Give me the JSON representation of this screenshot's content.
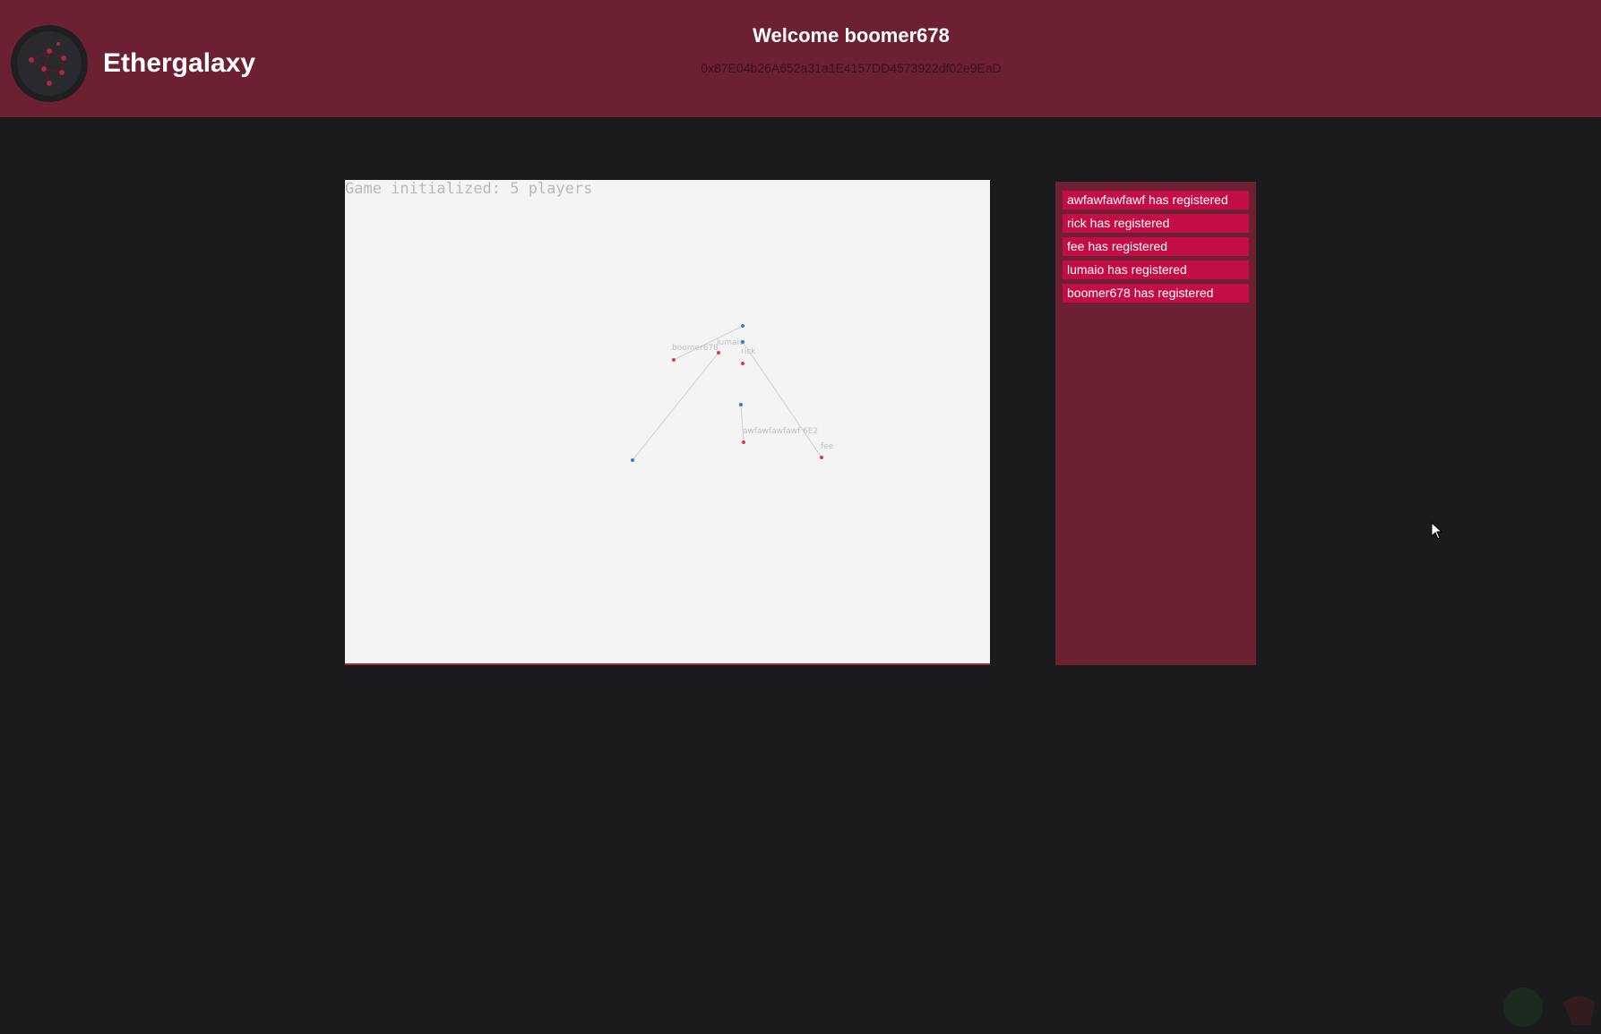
{
  "header": {
    "brand": "Ethergalaxy",
    "welcome": "Welcome boomer678",
    "address": "0x87E04b26A652a31a1E4157DD4573922df02e9EaD"
  },
  "game": {
    "status": "Game initialized: 5 players",
    "player_labels": [
      "boomer678",
      "lumaio",
      "rick",
      "awfawfawfawf 6E2",
      "fee"
    ]
  },
  "events": [
    "awfawfawfawf has registered",
    "rick has registered",
    "fee has registered",
    "lumaio has registered",
    "boomer678 has registered"
  ],
  "colors": {
    "header_bg": "#6e2033",
    "page_bg": "#1b1b1d",
    "event_bg": "#c40d44",
    "canvas_bg": "#f4f4f4",
    "red_dot": "#e03a3a",
    "blue_dot": "#2a7fd4"
  },
  "icons": {
    "logo": "galaxy-network-logo-icon",
    "cursor": "mouse-pointer-icon"
  }
}
